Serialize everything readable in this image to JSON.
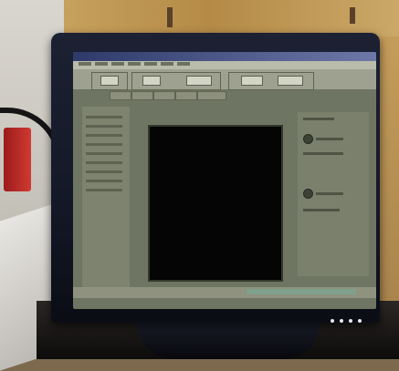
{
  "scene": {
    "description_visible_text": "",
    "monitor": {
      "brand_text": "",
      "led_count": 4
    }
  },
  "app": {
    "title": "",
    "menu_count": 7,
    "toolbar_button_count": 5,
    "tab_count": 5
  }
}
